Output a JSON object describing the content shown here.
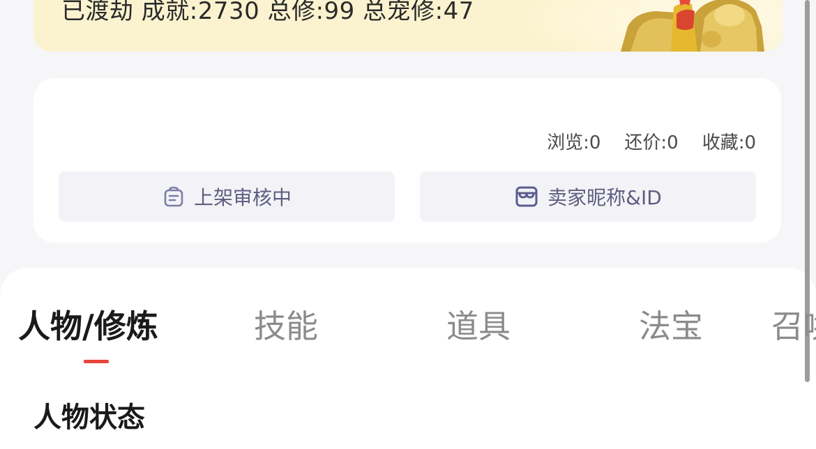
{
  "header_card": {
    "stats_line": "已渡劫 成就:2730 总修:99 总宠修:47"
  },
  "info_card": {
    "counters": [
      {
        "label": "浏览:0"
      },
      {
        "label": "还价:0"
      },
      {
        "label": "收藏:0"
      }
    ],
    "buttons": {
      "listing_status": "上架审核中",
      "seller_info": "卖家昵称&ID"
    }
  },
  "tabs": [
    {
      "label": "人物/修炼",
      "active": true
    },
    {
      "label": "技能",
      "active": false
    },
    {
      "label": "道具",
      "active": false
    },
    {
      "label": "法宝",
      "active": false
    },
    {
      "label": "召唤",
      "active": false
    }
  ],
  "section": {
    "title": "人物状态"
  },
  "colors": {
    "accent": "#e8453c",
    "header_bg": "#fbf3cf",
    "button_text": "#5d5d80"
  },
  "icons": [
    "bag-icon",
    "store-icon"
  ]
}
